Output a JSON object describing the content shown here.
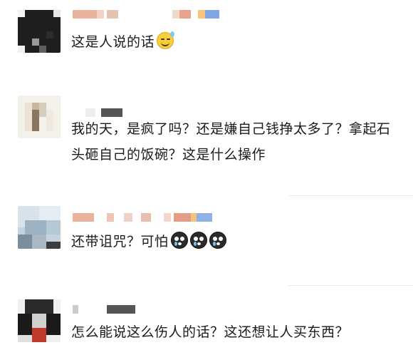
{
  "comments": [
    {
      "text": "这是人说的话",
      "emojis": [
        "sweat-smile-emoji"
      ]
    },
    {
      "text": "我的天，是疯了吗？还是嫌自己钱挣太多了？拿起石头砸自己的饭碗？这是什么操作",
      "emojis": []
    },
    {
      "text": "还带诅咒？可怕",
      "emojis": [
        "fearful-emoji",
        "fearful-emoji",
        "fearful-emoji"
      ]
    },
    {
      "text": "怎么能说这么伤人的话？这还想让人买东西？",
      "emojis": []
    }
  ],
  "colors": {
    "text": "#1a1a1a",
    "divider": "#ececec",
    "background": "#ffffff"
  }
}
